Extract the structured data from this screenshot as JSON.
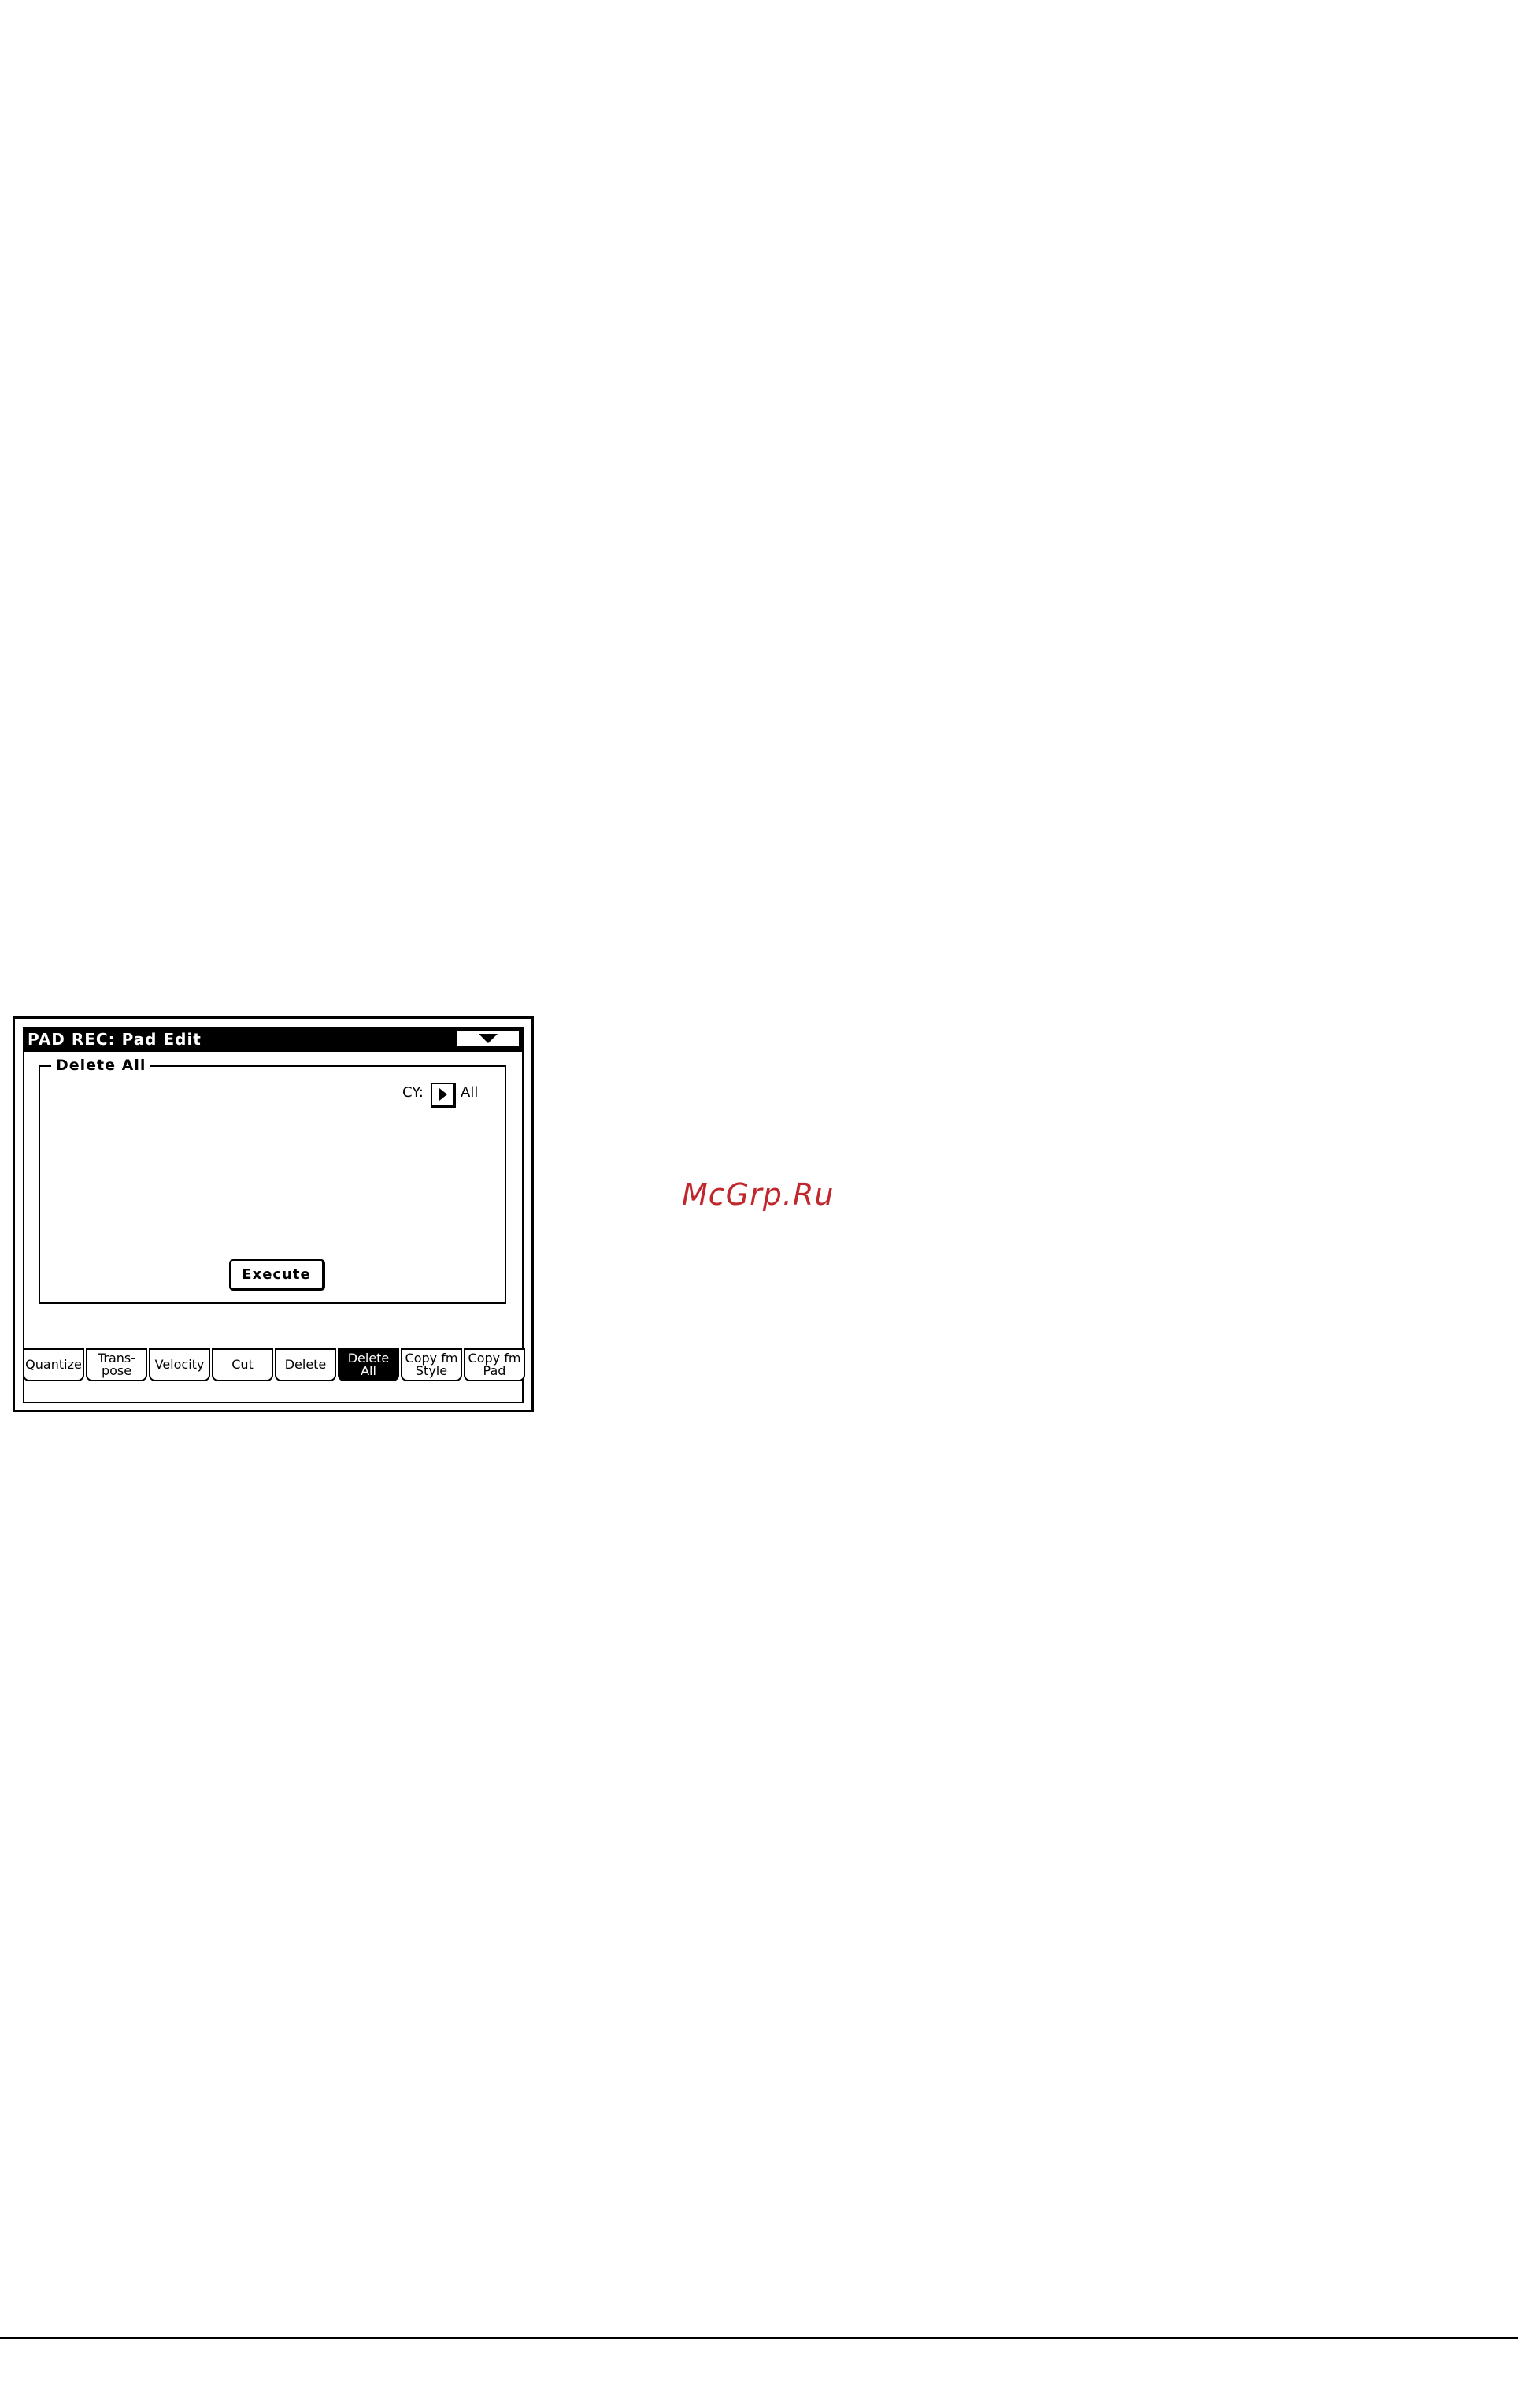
{
  "screen": {
    "title": "PAD REC: Pad Edit",
    "menu_icon": "triangle-down-icon"
  },
  "group": {
    "label": "Delete All",
    "cy_label": "CY:",
    "cy_value": "All",
    "execute_label": "Execute"
  },
  "tabs": [
    {
      "label": "Quantize",
      "active": false
    },
    {
      "label": "Trans-\npose",
      "active": false
    },
    {
      "label": "Velocity",
      "active": false
    },
    {
      "label": "Cut",
      "active": false
    },
    {
      "label": "Delete",
      "active": false
    },
    {
      "label": "Delete\nAll",
      "active": true
    },
    {
      "label": "Copy fm\nStyle",
      "active": false
    },
    {
      "label": "Copy fm\nPad",
      "active": false
    }
  ],
  "watermark": "McGrp.Ru",
  "colors": {
    "watermark": "#c0282d",
    "lcd_fg": "#000000",
    "lcd_bg": "#ffffff"
  }
}
